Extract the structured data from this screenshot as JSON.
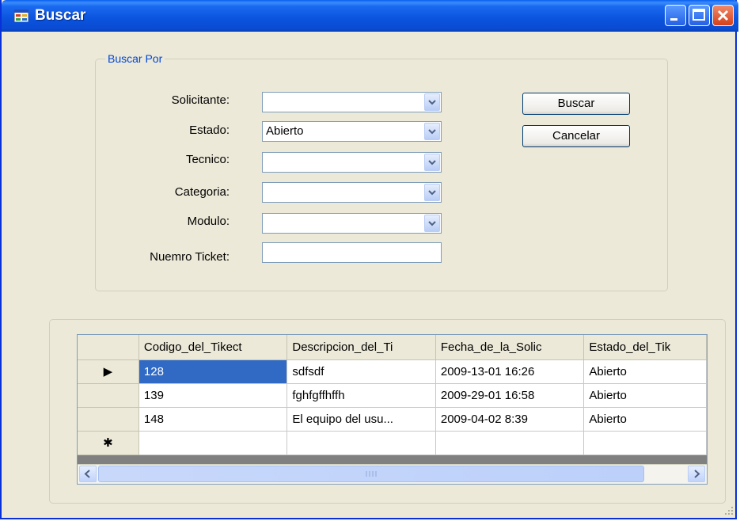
{
  "window": {
    "title": "Buscar",
    "accent": "#0a4bd2"
  },
  "search_group": {
    "legend": "Buscar Por",
    "fields": {
      "solicitante": {
        "label": "Solicitante:",
        "value": ""
      },
      "estado": {
        "label": "Estado:",
        "value": "Abierto"
      },
      "tecnico": {
        "label": "Tecnico:",
        "value": ""
      },
      "categoria": {
        "label": "Categoria:",
        "value": ""
      },
      "modulo": {
        "label": "Modulo:",
        "value": ""
      },
      "ticket": {
        "label": "Nuemro Ticket:",
        "value": ""
      }
    },
    "buttons": {
      "search_label": "Buscar",
      "cancel_label": "Cancelar"
    }
  },
  "grid": {
    "columns": [
      "Codigo_del_Tikect",
      "Descripcion_del_Ti",
      "Fecha_de_la_Solic",
      "Estado_del_Tik"
    ],
    "rows": [
      [
        "128",
        "sdfsdf",
        "2009-13-01 16:26",
        "Abierto"
      ],
      [
        "139",
        "fghfgffhffh",
        "2009-29-01 16:58",
        "Abierto"
      ],
      [
        "148",
        "El equipo del usu...",
        "2009-04-02 8:39",
        "Abierto"
      ]
    ],
    "new_row_marker": "✱",
    "current_row_marker": "▶",
    "selection_color": "#316ac5"
  },
  "icons": {
    "scroll_left": "◀",
    "scroll_right": "▶",
    "scroll_grip": "|||"
  }
}
